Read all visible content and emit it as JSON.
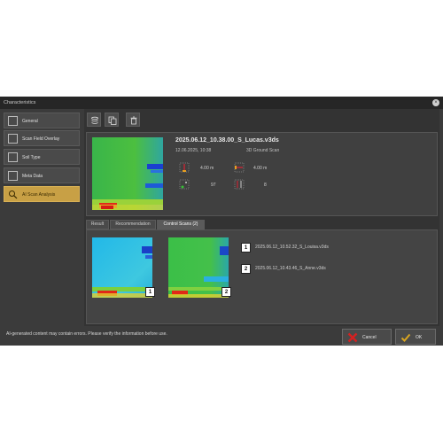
{
  "window": {
    "title": "Characteristics"
  },
  "sidebar": {
    "items": [
      {
        "label": "General",
        "icon": "sliders-icon"
      },
      {
        "label": "Scan Field Overlay",
        "icon": "image-icon"
      },
      {
        "label": "Soil Type",
        "icon": "layers-icon"
      },
      {
        "label": "Meta Data",
        "icon": "folder-icon"
      },
      {
        "label": "AI Scan Analysis",
        "icon": "ai-search-icon"
      }
    ],
    "active_index": 4
  },
  "toolbar": {
    "buttons": [
      "stack-icon",
      "copy-icon",
      "trash-icon"
    ]
  },
  "scan": {
    "filename": "2025.06.12_10.38.00_S_Lucas.v3ds",
    "datetime": "12.06.2025, 10:38",
    "type": "3D Ground Scan",
    "length_1": "4.00 m",
    "length_2": "4.00 m",
    "count_1": "97",
    "count_2": "8"
  },
  "tabs": [
    {
      "label": "Result"
    },
    {
      "label": "Recommendation"
    },
    {
      "label": "Control Scans (2)"
    }
  ],
  "active_tab": 2,
  "control_scans": [
    {
      "badge": "1",
      "label": "2025.06.12_10.52.32_S_Louisa.v3ds"
    },
    {
      "badge": "2",
      "label": "2025.06.12_10.43.46_S_Anne.v3ds"
    }
  ],
  "footer": {
    "disclaimer": "AI-generated content may contain errors. Please verify the information before use.",
    "cancel_label": "Cancel",
    "ok_label": "OK"
  },
  "colors": {
    "accent": "#c8a045",
    "cancel_x": "#d62020",
    "ok_check": "#d9a520"
  }
}
